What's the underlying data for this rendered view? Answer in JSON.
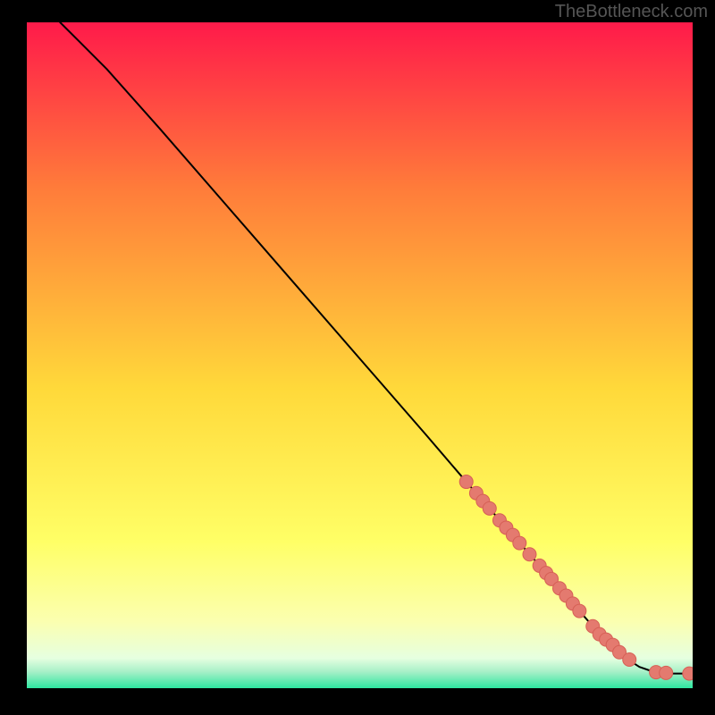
{
  "watermark": "TheBottleneck.com",
  "colors": {
    "gradient_top": "#ff1a4a",
    "gradient_mid1": "#ff7c3a",
    "gradient_mid2": "#ffd93a",
    "gradient_mid3": "#ffff66",
    "gradient_mid4": "#fbffb0",
    "gradient_bottom_pale": "#e6ffe0",
    "gradient_bottom": "#2ee6a0",
    "curve": "#000000",
    "marker_fill": "#e47a6f",
    "marker_stroke": "#d65f55"
  },
  "chart_data": {
    "type": "line",
    "title": "",
    "xlabel": "",
    "ylabel": "",
    "xlim": [
      0,
      100
    ],
    "ylim": [
      0,
      100
    ],
    "curve": {
      "x": [
        5,
        8,
        12,
        20,
        30,
        40,
        50,
        60,
        66,
        70,
        75,
        80,
        85,
        88,
        90,
        92,
        94,
        97,
        100
      ],
      "y": [
        100,
        97,
        93,
        84,
        72.5,
        61,
        49.5,
        38,
        31,
        26.4,
        20.7,
        15,
        9.3,
        6.5,
        4.5,
        3.2,
        2.5,
        2.2,
        2.2
      ]
    },
    "markers": {
      "x": [
        66,
        67.5,
        68.5,
        69.5,
        71,
        72,
        73,
        74,
        75.5,
        77,
        78,
        78.8,
        80,
        81,
        82,
        83,
        85,
        86,
        87,
        88,
        89,
        90.5,
        94.5,
        96,
        99.5
      ],
      "y": [
        31,
        29.3,
        28.1,
        27,
        25.2,
        24.1,
        23,
        21.8,
        20.1,
        18.4,
        17.3,
        16.4,
        15,
        13.9,
        12.7,
        11.6,
        9.3,
        8.1,
        7.3,
        6.5,
        5.4,
        4.3,
        2.4,
        2.3,
        2.2
      ]
    }
  }
}
